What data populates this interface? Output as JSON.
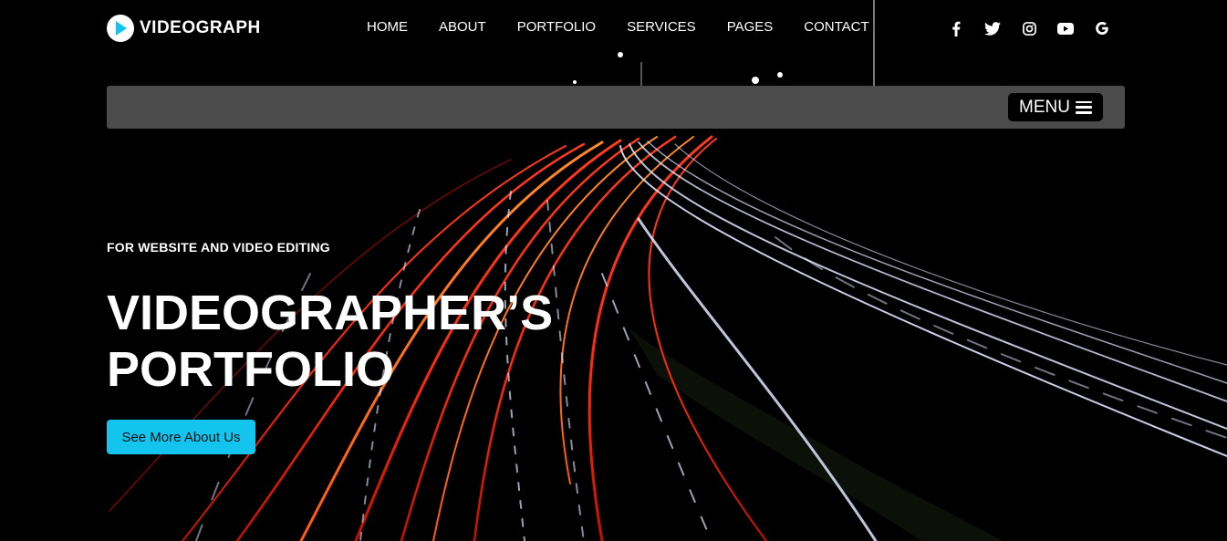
{
  "brand": {
    "logo_text": "VIDEOGRAPH",
    "logo_icon": "play-icon",
    "accent_color": "#13c5ee"
  },
  "nav": {
    "items": [
      {
        "label": "HOME"
      },
      {
        "label": "ABOUT"
      },
      {
        "label": "PORTFOLIO"
      },
      {
        "label": "SERVICES"
      },
      {
        "label": "PAGES"
      },
      {
        "label": "CONTACT"
      }
    ]
  },
  "social": {
    "icons": [
      "facebook-icon",
      "twitter-icon",
      "instagram-icon",
      "youtube-icon",
      "google-icon"
    ]
  },
  "menubar": {
    "menu_label": "MENU",
    "menu_icon": "hamburger-icon",
    "background": "#4b4b4b"
  },
  "hero": {
    "subtitle": "FOR WEBSITE AND VIDEO EDITING",
    "title_line1": "VIDEOGRAPHER’S",
    "title_line2": "PORTFOLIO",
    "cta_label": "See More About Us",
    "background": "night highway light trails"
  }
}
